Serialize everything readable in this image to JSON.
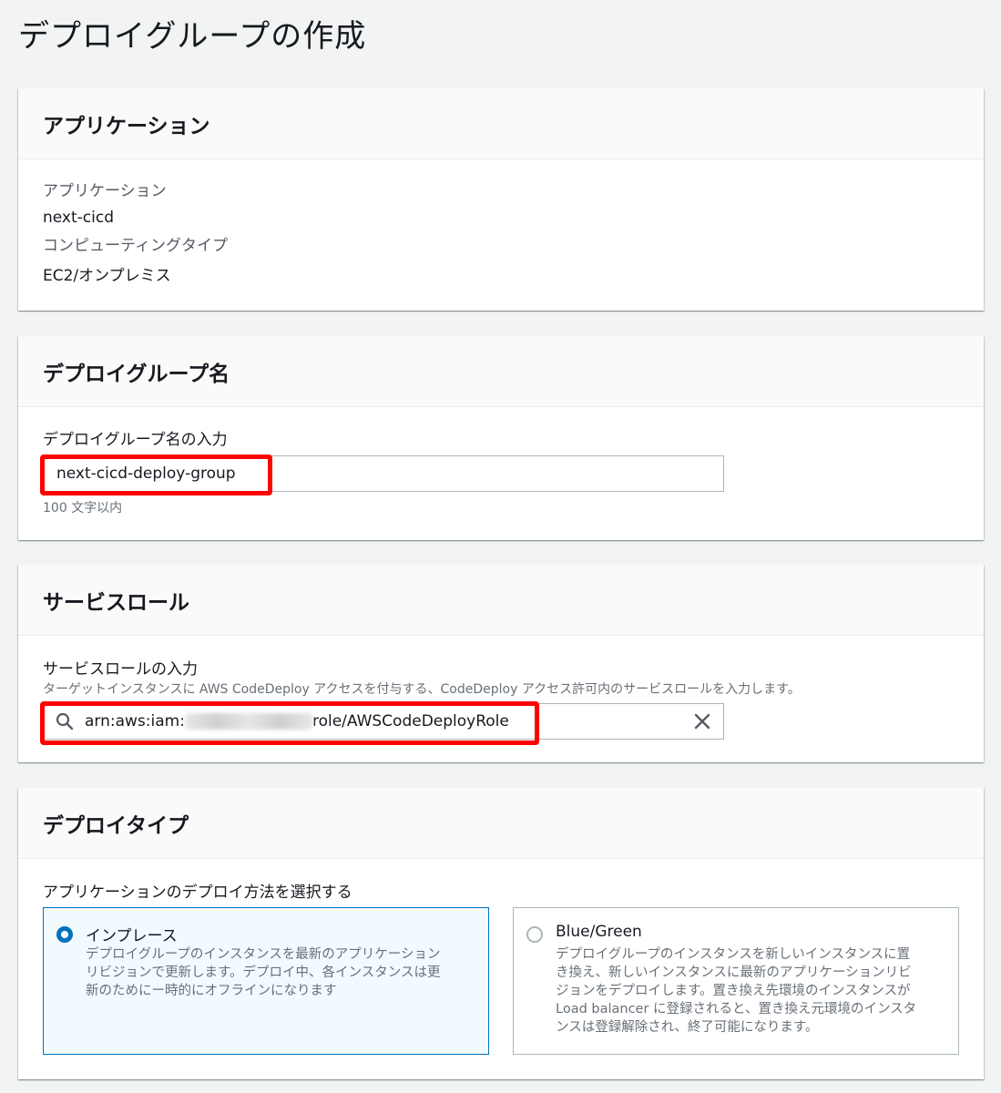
{
  "page": {
    "title": "デプロイグループの作成"
  },
  "application_panel": {
    "header": "アプリケーション",
    "app_label": "アプリケーション",
    "app_value": "next-cicd",
    "compute_label": "コンピューティングタイプ",
    "compute_value": "EC2/オンプレミス"
  },
  "deploy_group_panel": {
    "header": "デプロイグループ名",
    "input_label": "デプロイグループ名の入力",
    "input_value": "next-cicd-deploy-group",
    "constraint": "100 文字以内"
  },
  "service_role_panel": {
    "header": "サービスロール",
    "input_label": "サービスロールの入力",
    "description": "ターゲットインスタンスに AWS CodeDeploy アクセスを付与する、CodeDeploy アクセス許可内のサービスロールを入力します。",
    "value_prefix": "arn:aws:iam:",
    "value_suffix": "role/AWSCodeDeployRole",
    "search_icon": "search-icon",
    "clear_icon": "close-icon"
  },
  "deploy_type_panel": {
    "header": "デプロイタイプ",
    "prompt": "アプリケーションのデプロイ方法を選択する",
    "options": [
      {
        "title": "インプレース",
        "description_lines": [
          "デプロイグループのインスタンスを最新のアプリケーション",
          "リビジョンで更新します。デプロイ中、各インスタンスは更",
          "新のためにー時的にオフラインになります"
        ],
        "selected": true
      },
      {
        "title": "Blue/Green",
        "description_lines": [
          "デプロイグループのインスタンスを新しいインスタンスに置",
          "き換え、新しいインスタンスに最新のアプリケーションリビ",
          "ジョンをデプロイします。置き換え先環境のインスタンスが",
          "Load balancer に登録されると、置き換え元環境のインスタ",
          "ンスは登録解除され、終了可能になります。"
        ],
        "selected": false
      }
    ]
  },
  "colors": {
    "accent": "#0073bb",
    "highlight": "#ff0000",
    "background": "#f2f3f3"
  }
}
